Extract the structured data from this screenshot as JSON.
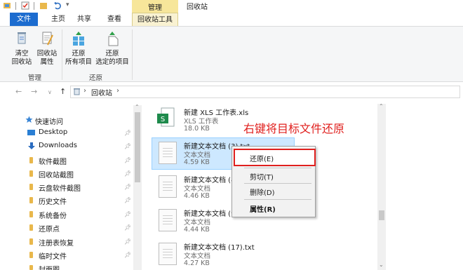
{
  "window": {
    "context_tab_header": "管理",
    "title": "回收站"
  },
  "tabs": {
    "file": "文件",
    "home": "主页",
    "share": "共享",
    "view": "查看",
    "tools": "回收站工具"
  },
  "ribbon": {
    "empty_bin": [
      "清空",
      "回收站"
    ],
    "bin_properties": [
      "回收站",
      "属性"
    ],
    "restore_all": [
      "还原",
      "所有项目"
    ],
    "restore_selected": [
      "还原",
      "选定的项目"
    ],
    "group_manage": "管理",
    "group_restore": "还原"
  },
  "address": {
    "path_item": "回收站",
    "separator": "›"
  },
  "nav": {
    "quick_access": "快速访问",
    "items": [
      "Desktop",
      "Downloads",
      "软件截图",
      "回收站截图",
      "云盘软件截图",
      "历史文件",
      "系统备份",
      "还原点",
      "注册表恢复",
      "临时文件",
      "封面图"
    ]
  },
  "files": [
    {
      "name": "新建 XLS 工作表.xls",
      "type": "XLS 工作表",
      "size": "18.0 KB",
      "icon": "xls-file-icon"
    },
    {
      "name": "新建文本文档 (3).txt",
      "type": "文本文档",
      "size": "4.59 KB",
      "icon": "text-file-icon"
    },
    {
      "name": "新建文本文档 (4",
      "type": "文本文档",
      "size": "4.46 KB",
      "icon": "text-file-icon"
    },
    {
      "name": "新建文本文档 (9",
      "type": "文本文档",
      "size": "4.44 KB",
      "icon": "text-file-icon"
    },
    {
      "name": "新建文本文档 (17).txt",
      "type": "文本文档",
      "size": "4.27 KB",
      "icon": "text-file-icon"
    }
  ],
  "annotation": "右键将目标文件还原",
  "context_menu": {
    "restore": "还原(E)",
    "cut": "剪切(T)",
    "delete": "删除(D)",
    "properties": "属性(R)"
  },
  "colors": {
    "file_tab": "#1c6ccf",
    "context_tab": "#f7e69a",
    "selection": "#cde8ff",
    "annotation": "#e0201e",
    "folder": "#e9b84c"
  }
}
